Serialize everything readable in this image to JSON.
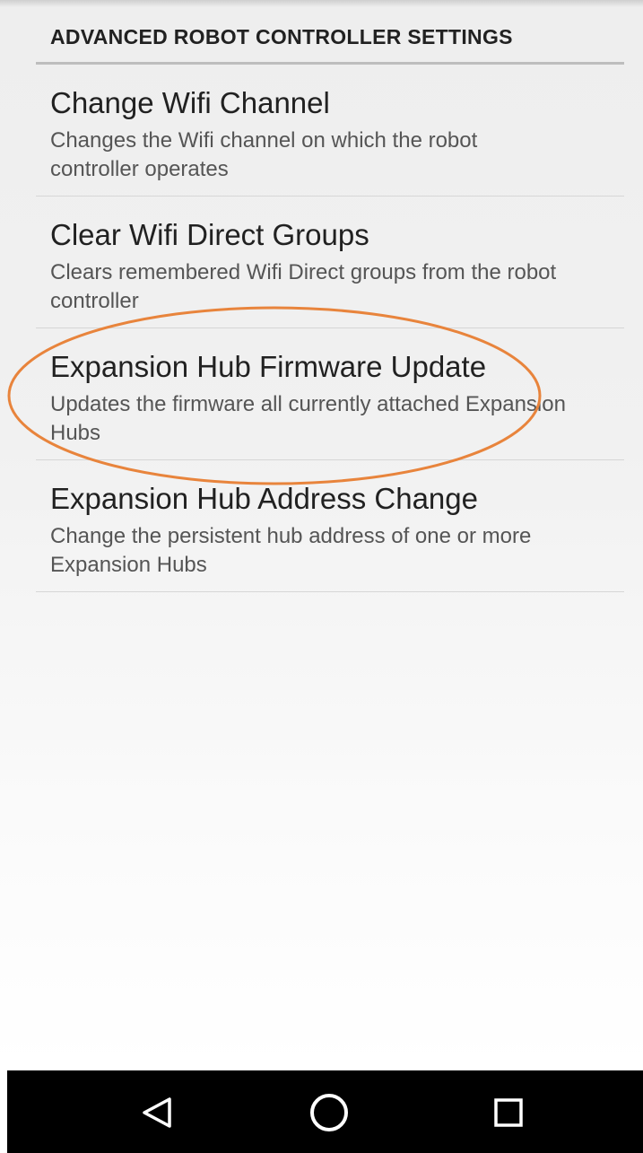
{
  "header": {
    "title": "ADVANCED ROBOT CONTROLLER SETTINGS"
  },
  "preferences": [
    {
      "title": "Change Wifi Channel",
      "summary": "Changes the Wifi channel on which the robot controller operates"
    },
    {
      "title": "Clear Wifi Direct Groups",
      "summary": "Clears remembered Wifi Direct groups from the robot controller"
    },
    {
      "title": "Expansion Hub Firmware Update",
      "summary": "Updates the firmware all currently attached Expansion Hubs"
    },
    {
      "title": "Expansion Hub Address Change",
      "summary": "Change the persistent hub address of one or more Expansion Hubs"
    }
  ],
  "annotation": {
    "highlight_color": "#e8843c",
    "highlighted_item": "Expansion Hub Firmware Update"
  },
  "nav_bar": {
    "back_icon": "back-triangle-icon",
    "home_icon": "home-circle-icon",
    "recents_icon": "recents-square-icon",
    "icon_color": "#ffffff"
  }
}
